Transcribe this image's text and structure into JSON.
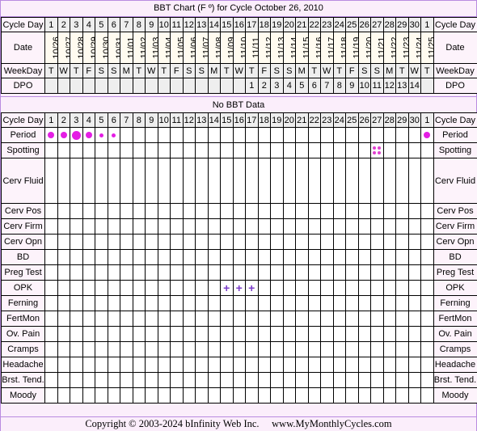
{
  "title": "BBT Chart (F º) for Cycle October 26, 2010",
  "no_bbt_label": "No BBT Data",
  "footer": "Copyright © 2003-2024 bInfinity Web Inc.     www.MyMonthlyCycles.com",
  "colors": {
    "period": "#e41ee4",
    "spotting": "#e040d0",
    "opk": "#7a3cc8",
    "frame": "#b98be0"
  },
  "chart_data": {
    "type": "table",
    "title": "BBT Chart (F º) for Cycle October 26, 2010",
    "cycle_days": [
      "1",
      "2",
      "3",
      "4",
      "5",
      "6",
      "7",
      "8",
      "9",
      "10",
      "11",
      "12",
      "13",
      "14",
      "15",
      "16",
      "17",
      "18",
      "19",
      "20",
      "21",
      "22",
      "23",
      "24",
      "25",
      "26",
      "27",
      "28",
      "29",
      "30",
      "1"
    ],
    "dates": [
      "10/26",
      "10/27",
      "10/28",
      "10/29",
      "10/30",
      "10/31",
      "11/01",
      "11/02",
      "11/03",
      "11/04",
      "11/05",
      "11/06",
      "11/07",
      "11/08",
      "11/09",
      "11/10",
      "11/11",
      "11/12",
      "11/13",
      "11/14",
      "11/15",
      "11/16",
      "11/17",
      "11/18",
      "11/19",
      "11/20",
      "11/21",
      "11/22",
      "11/23",
      "11/24",
      "11/25"
    ],
    "weekdays": [
      "T",
      "W",
      "T",
      "F",
      "S",
      "S",
      "M",
      "T",
      "W",
      "T",
      "F",
      "S",
      "S",
      "M",
      "T",
      "W",
      "T",
      "F",
      "S",
      "S",
      "M",
      "T",
      "W",
      "T",
      "F",
      "S",
      "S",
      "M",
      "T",
      "W",
      "T"
    ],
    "dpo": [
      "",
      "",
      "",
      "",
      "",
      "",
      "",
      "",
      "",
      "",
      "",
      "",
      "",
      "",
      "",
      "",
      "1",
      "2",
      "3",
      "4",
      "5",
      "6",
      "7",
      "8",
      "9",
      "10",
      "11",
      "12",
      "13",
      "14",
      ""
    ],
    "period": [
      "medium",
      "medium",
      "heavy",
      "medium",
      "light",
      "light",
      "",
      "",
      "",
      "",
      "",
      "",
      "",
      "",
      "",
      "",
      "",
      "",
      "",
      "",
      "",
      "",
      "",
      "",
      "",
      "",
      "",
      "",
      "",
      "",
      "medium"
    ],
    "spotting": [
      "",
      "",
      "",
      "",
      "",
      "",
      "",
      "",
      "",
      "",
      "",
      "",
      "",
      "",
      "",
      "",
      "",
      "",
      "",
      "",
      "",
      "",
      "",
      "",
      "",
      "",
      "yes",
      "",
      "",
      "",
      ""
    ],
    "opk": [
      "",
      "",
      "",
      "",
      "",
      "",
      "",
      "",
      "",
      "",
      "",
      "",
      "",
      "",
      "positive",
      "positive",
      "positive",
      "",
      "",
      "",
      "",
      "",
      "",
      "",
      "",
      "",
      "",
      "",
      "",
      "",
      ""
    ],
    "labels": {
      "cycle_day": "Cycle Day",
      "date": "Date",
      "weekday": "WeekDay",
      "dpo": "DPO",
      "period": "Period",
      "spotting": "Spotting",
      "cerv_fluid": "Cerv Fluid",
      "cerv_pos": "Cerv Pos",
      "cerv_firm": "Cerv Firm",
      "cerv_opn": "Cerv Opn",
      "bd": "BD",
      "preg_test": "Preg Test",
      "opk": "OPK",
      "ferning": "Ferning",
      "fertmon": "FertMon",
      "ov_pain": "Ov. Pain",
      "cramps": "Cramps",
      "headache": "Headache",
      "brst_tend": "Brst. Tend.",
      "moody": "Moody"
    }
  }
}
